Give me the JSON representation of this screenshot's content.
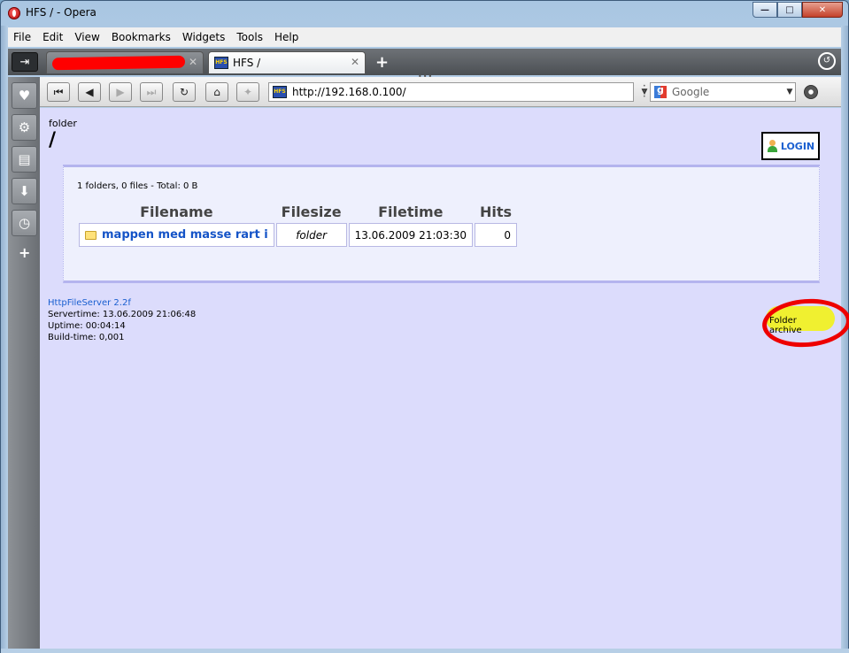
{
  "window": {
    "title": "HFS / - Opera"
  },
  "menu": [
    "File",
    "Edit",
    "View",
    "Bookmarks",
    "Widgets",
    "Tools",
    "Help"
  ],
  "tabs": [
    {
      "title": "",
      "redacted": true,
      "active": false
    },
    {
      "title": "HFS /",
      "active": true
    }
  ],
  "toolbar": {
    "address": "http://192.168.0.100/",
    "search_placeholder": "Google"
  },
  "page": {
    "folder_label": "folder",
    "path": "/",
    "login": "LOGIN",
    "summary": "1 folders, 0 files - Total: 0 B",
    "columns": [
      "Filename",
      "Filesize",
      "Filetime",
      "Hits"
    ],
    "rows": [
      {
        "name": "mappen med masse rart i",
        "size": "folder",
        "time": "13.06.2009 21:03:30",
        "hits": "0"
      }
    ],
    "archive": "Folder archive",
    "footer": {
      "server": "HttpFileServer 2.2f",
      "servertime": "Servertime: 13.06.2009 21:06:48",
      "uptime": "Uptime: 00:04:14",
      "buildtime": "Build-time: 0,001"
    }
  },
  "colors": {
    "page_bg": "#dcdcfc",
    "link": "#1554c7",
    "annotation": "#ee0000",
    "highlight": "#f2f21a"
  }
}
